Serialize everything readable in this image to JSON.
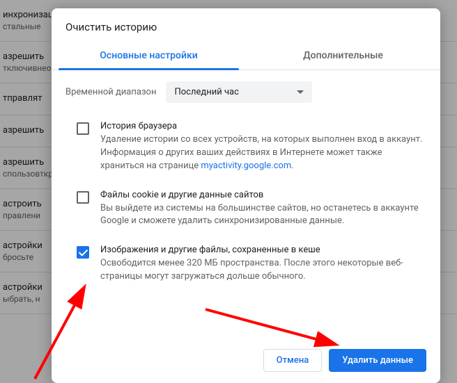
{
  "background": {
    "rows": [
      {
        "title": "инхронизация сервисов Google",
        "sub": "стальные"
      },
      {
        "title": "азрешить",
        "sub": "тключивнеобходим"
      },
      {
        "title": "тправлят",
        "sub": ""
      },
      {
        "title": "азрешить",
        "sub": ""
      },
      {
        "title": "азрешить",
        "sub": "спользовткрывает"
      },
      {
        "title": "астроить",
        "sub": "правлени"
      },
      {
        "title": "астройки",
        "sub": "бросьте"
      },
      {
        "title": "астройки",
        "sub": "ыбрать, н"
      }
    ]
  },
  "dialog": {
    "title": "Очистить историю",
    "tabs": {
      "basic": "Основные настройки",
      "advanced": "Дополнительные"
    },
    "range_label": "Временной диапазон",
    "range_value": "Последний час",
    "items": [
      {
        "title": "История браузера",
        "desc_pre": "Удаление истории со всех устройств, на которых выполнен вход в аккаунт. Информация о других ваших действиях в Интернете может также храниться на странице ",
        "link": "myactivity.google.com",
        "desc_post": ".",
        "checked": false
      },
      {
        "title": "Файлы cookie и другие данные сайтов",
        "desc_pre": "Вы выйдете из системы на большинстве сайтов, но останетесь в аккаунте Google и сможете удалить синхронизированные данные.",
        "link": "",
        "desc_post": "",
        "checked": false
      },
      {
        "title": "Изображения и другие файлы, сохраненные в кеше",
        "desc_pre": "Освободится менее 320 МБ пространства. После этого некоторые веб-страницы могут загружаться дольше обычного.",
        "link": "",
        "desc_post": "",
        "checked": true
      }
    ],
    "actions": {
      "cancel": "Отмена",
      "clear": "Удалить данные"
    }
  }
}
